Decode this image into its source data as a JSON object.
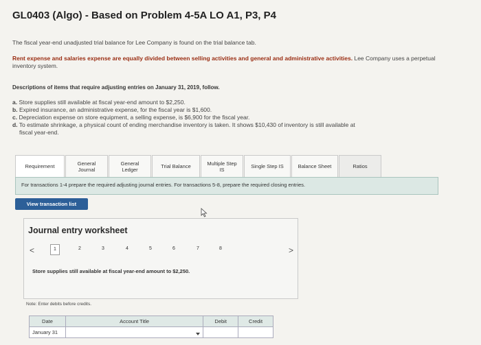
{
  "header": {
    "title": "GL0403 (Algo) - Based on Problem 4-5A LO A1, P3, P4"
  },
  "intro": "The fiscal year-end unadjusted trial balance for Lee Company is found on the trial balance tab.",
  "note_bold": "Rent expense and salaries expense are equally divided between selling activities and general and administrative activities.",
  "note_rest": "Lee Company uses a perpetual inventory system.",
  "desc_heading": "Descriptions of items that require adjusting entries on January 31, 2019, follow.",
  "items": [
    {
      "key": "a.",
      "text": "Store supplies still available at fiscal year-end amount to $2,250."
    },
    {
      "key": "b.",
      "text": "Expired insurance, an administrative expense, for the fiscal year is $1,600."
    },
    {
      "key": "c.",
      "text": "Depreciation expense on store equipment, a selling expense, is $6,900 for the fiscal year."
    },
    {
      "key": "d.",
      "text": "To estimate shrinkage, a physical count of ending merchandise inventory is taken. It shows $10,430 of inventory is still available at"
    },
    {
      "key": "",
      "text": "fiscal year-end."
    }
  ],
  "tabs": [
    {
      "label": "Requirement"
    },
    {
      "label": "General Journal"
    },
    {
      "label": "General Ledger"
    },
    {
      "label": "Trial Balance"
    },
    {
      "label": "Multiple Step IS"
    },
    {
      "label": "Single Step IS"
    },
    {
      "label": "Balance Sheet"
    },
    {
      "label": "Ratios"
    }
  ],
  "banner": "For transactions 1-4 prepare the required adjusting journal entries. For transactions 5-8, prepare the required closing entries.",
  "view_button": "View transaction list",
  "worksheet": {
    "title": "Journal entry worksheet",
    "prev": "<",
    "next": ">",
    "pages": [
      "1",
      "2",
      "3",
      "4",
      "5",
      "6",
      "7",
      "8"
    ],
    "active_page": "1",
    "entry_text": "Store supplies still available at fiscal year-end amount to $2,250."
  },
  "note": "Note: Enter debits before credits.",
  "table": {
    "headers": [
      "Date",
      "Account Title",
      "Debit",
      "Credit"
    ],
    "date_value": "January 31"
  },
  "colors": {
    "accent": "#2c5f98",
    "banner": "#dce8e4",
    "title_red": "#9a2d12"
  }
}
